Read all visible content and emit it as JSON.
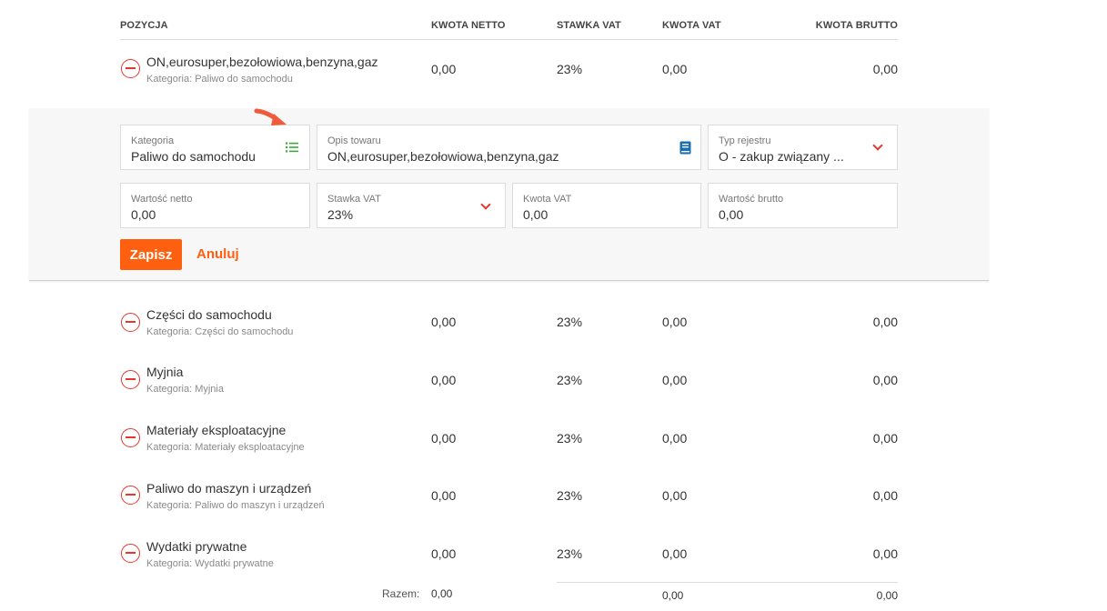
{
  "headers": {
    "pozycja": "POZYCJA",
    "kwota_netto": "KWOTA NETTO",
    "stawka_vat": "STAWKA VAT",
    "kwota_vat": "KWOTA VAT",
    "kwota_brutto": "KWOTA BRUTTO"
  },
  "rows": [
    {
      "name": "ON,eurosuper,bezołowiowa,benzyna,gaz",
      "category": "Kategoria: Paliwo do samochodu",
      "netto": "0,00",
      "vat_rate": "23%",
      "vat": "0,00",
      "brutto": "0,00"
    },
    {
      "name": "Części do samochodu",
      "category": "Kategoria: Części do samochodu",
      "netto": "0,00",
      "vat_rate": "23%",
      "vat": "0,00",
      "brutto": "0,00"
    },
    {
      "name": "Myjnia",
      "category": "Kategoria: Myjnia",
      "netto": "0,00",
      "vat_rate": "23%",
      "vat": "0,00",
      "brutto": "0,00"
    },
    {
      "name": "Materiały eksploatacyjne",
      "category": "Kategoria: Materiały eksploatacyjne",
      "netto": "0,00",
      "vat_rate": "23%",
      "vat": "0,00",
      "brutto": "0,00"
    },
    {
      "name": "Paliwo do maszyn i urządzeń",
      "category": "Kategoria: Paliwo do maszyn i urządzeń",
      "netto": "0,00",
      "vat_rate": "23%",
      "vat": "0,00",
      "brutto": "0,00"
    },
    {
      "name": "Wydatki prywatne",
      "category": "Kategoria: Wydatki prywatne",
      "netto": "0,00",
      "vat_rate": "23%",
      "vat": "0,00",
      "brutto": "0,00"
    }
  ],
  "edit_form": {
    "kategoria": {
      "label": "Kategoria",
      "value": "Paliwo do samochodu"
    },
    "opis": {
      "label": "Opis towaru",
      "value": "ON,eurosuper,bezołowiowa,benzyna,gaz"
    },
    "typ_rejestru": {
      "label": "Typ rejestru",
      "value": "O - zakup związany ..."
    },
    "wartosc_netto": {
      "label": "Wartość netto",
      "value": "0,00"
    },
    "stawka_vat": {
      "label": "Stawka VAT",
      "value": "23%"
    },
    "kwota_vat": {
      "label": "Kwota VAT",
      "value": "0,00"
    },
    "wartosc_brutto": {
      "label": "Wartość brutto",
      "value": "0,00"
    },
    "save_label": "Zapisz",
    "cancel_label": "Anuluj"
  },
  "totals": {
    "label": "Razem:",
    "netto": "0,00",
    "vat": "0,00",
    "brutto": "0,00"
  },
  "colors": {
    "accent": "#ff6010",
    "remove": "#e3382c",
    "list_icon": "#3aaa35",
    "book_icon": "#1a6fb0"
  },
  "icons": {
    "remove": "minus-circle-icon",
    "category_list": "list-icon",
    "description_book": "book-icon",
    "dropdown": "chevron-down-icon",
    "pointer": "arrow-pointer-icon"
  }
}
